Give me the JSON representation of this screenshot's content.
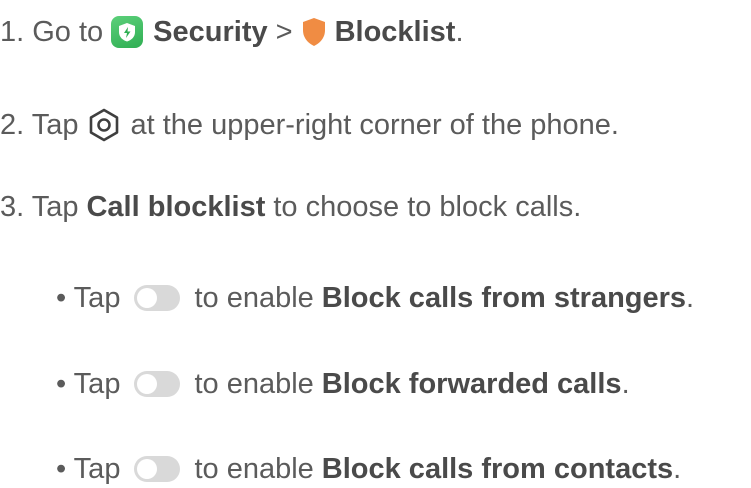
{
  "step1": {
    "prefix": "1. Go to",
    "security_label": "Security",
    "separator": ">",
    "blocklist_label": "Blocklist",
    "suffix": "."
  },
  "step2": {
    "prefix": "2. Tap",
    "suffix": "at the upper-right corner of the phone."
  },
  "step3": {
    "prefix": "3. Tap",
    "bold": "Call blocklist",
    "suffix": "to choose to block calls."
  },
  "bullets": [
    {
      "prefix": "• Tap",
      "middle": "to enable",
      "bold": "Block calls from strangers",
      "suffix": "."
    },
    {
      "prefix": "• Tap",
      "middle": "to enable",
      "bold": "Block forwarded calls",
      "suffix": "."
    },
    {
      "prefix": "• Tap",
      "middle": "to enable",
      "bold": "Block calls from contacts",
      "suffix": "."
    }
  ],
  "icons": {
    "security_app": "security-app-icon",
    "blocklist": "shield-icon",
    "settings": "gear-icon",
    "toggle": "toggle-switch-icon"
  },
  "colors": {
    "text": "#5b5b5b",
    "bold_text": "#4a4a4a",
    "security_green": "#2fae53",
    "shield_orange": "#f08c43",
    "toggle_off": "#d9d9d9"
  }
}
